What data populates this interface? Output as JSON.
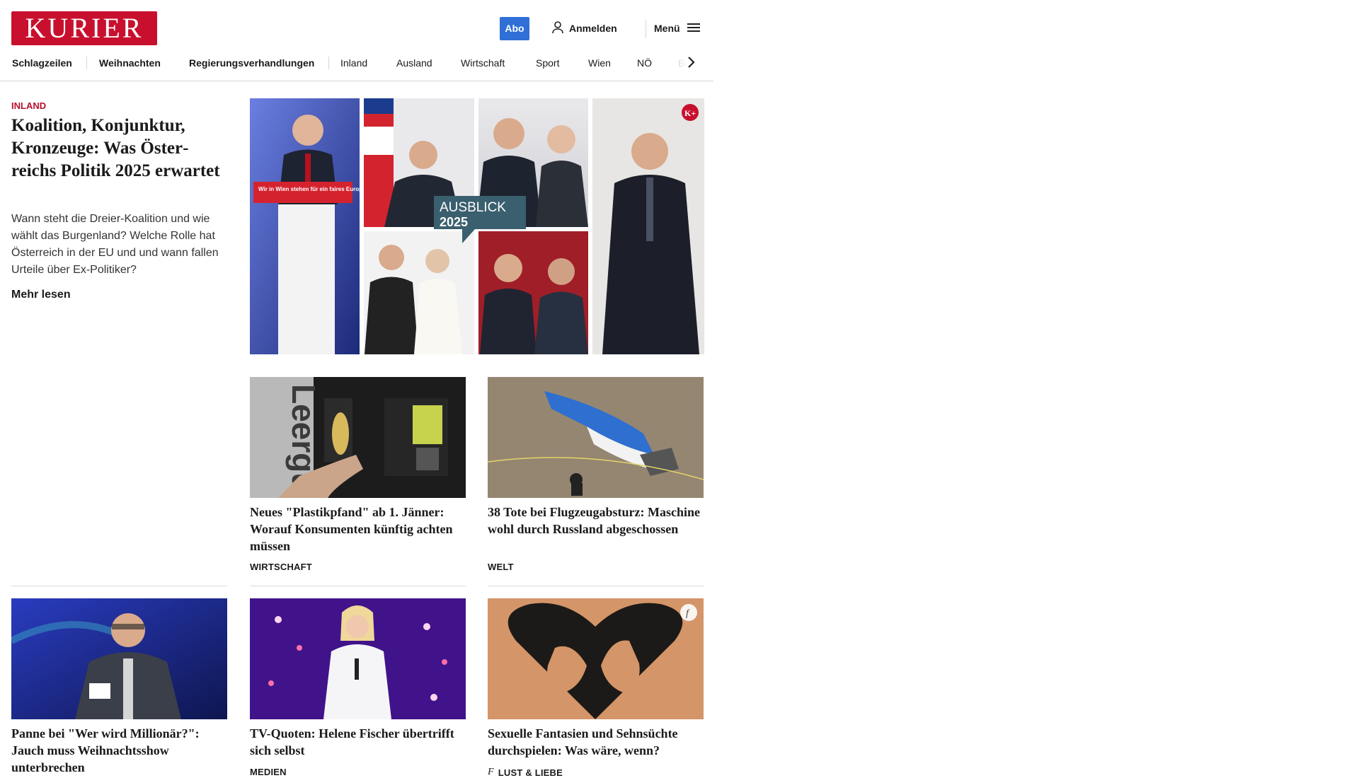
{
  "header": {
    "logo_text": "KURIER",
    "abo_label": "Abo",
    "login_label": "Anmelden",
    "menu_label": "Menü",
    "brand_color": "#c8102e",
    "accent_color": "#2f6fd6"
  },
  "nav": {
    "items": [
      {
        "label": "Schlagzeilen"
      },
      {
        "label": "Weihnachten"
      },
      {
        "label": "Regierungsverhandlungen"
      },
      {
        "label": "Inland"
      },
      {
        "label": "Ausland"
      },
      {
        "label": "Wirtschaft"
      },
      {
        "label": "Sport"
      },
      {
        "label": "Wien"
      },
      {
        "label": "NÖ"
      },
      {
        "label": "Bur"
      }
    ]
  },
  "lead": {
    "kicker": "INLAND",
    "title": "Koalition, Konjunktur, Kronzeuge: Was Öster­reichs Politik 2025 erwartet",
    "description": "Wann steht die Dreier-Koalition und wie wählt das Burgenland? Welche Rolle hat Österreich in der EU und und wann fallen Urteile über Ex-Politiker?",
    "more_label": "Mehr lesen",
    "image_badge": "K+",
    "image_overlay_title": "AUSBLICK",
    "image_overlay_year": "2025",
    "image_banner_text": "Wir in Wien stehen für ein faires Europa."
  },
  "cards": [
    {
      "title": "Neues \"Plastikpfand\" ab 1. Jänner: Worauf Konsumenten künftig ach­ten müssen",
      "category": "WIRTSCHAFT",
      "image_text": "Leergut"
    },
    {
      "title": "38 Tote bei Flugzeugabsturz: Ma­schine wohl durch Russland abgeschossen",
      "category": "WELT"
    },
    {
      "title": "Panne bei \"Wer wird Millionär?\": Jauch muss Weihnachtsshow unterbrechen",
      "category": ""
    },
    {
      "title": "TV-Quoten: Helene Fischer über­trifft sich selbst",
      "category": "MEDIEN"
    },
    {
      "title": "Sexuelle Fantasien und Sehnsüchte durchspielen: Was wäre, wenn?",
      "category": "LUST & LIEBE",
      "badge": "f"
    }
  ]
}
